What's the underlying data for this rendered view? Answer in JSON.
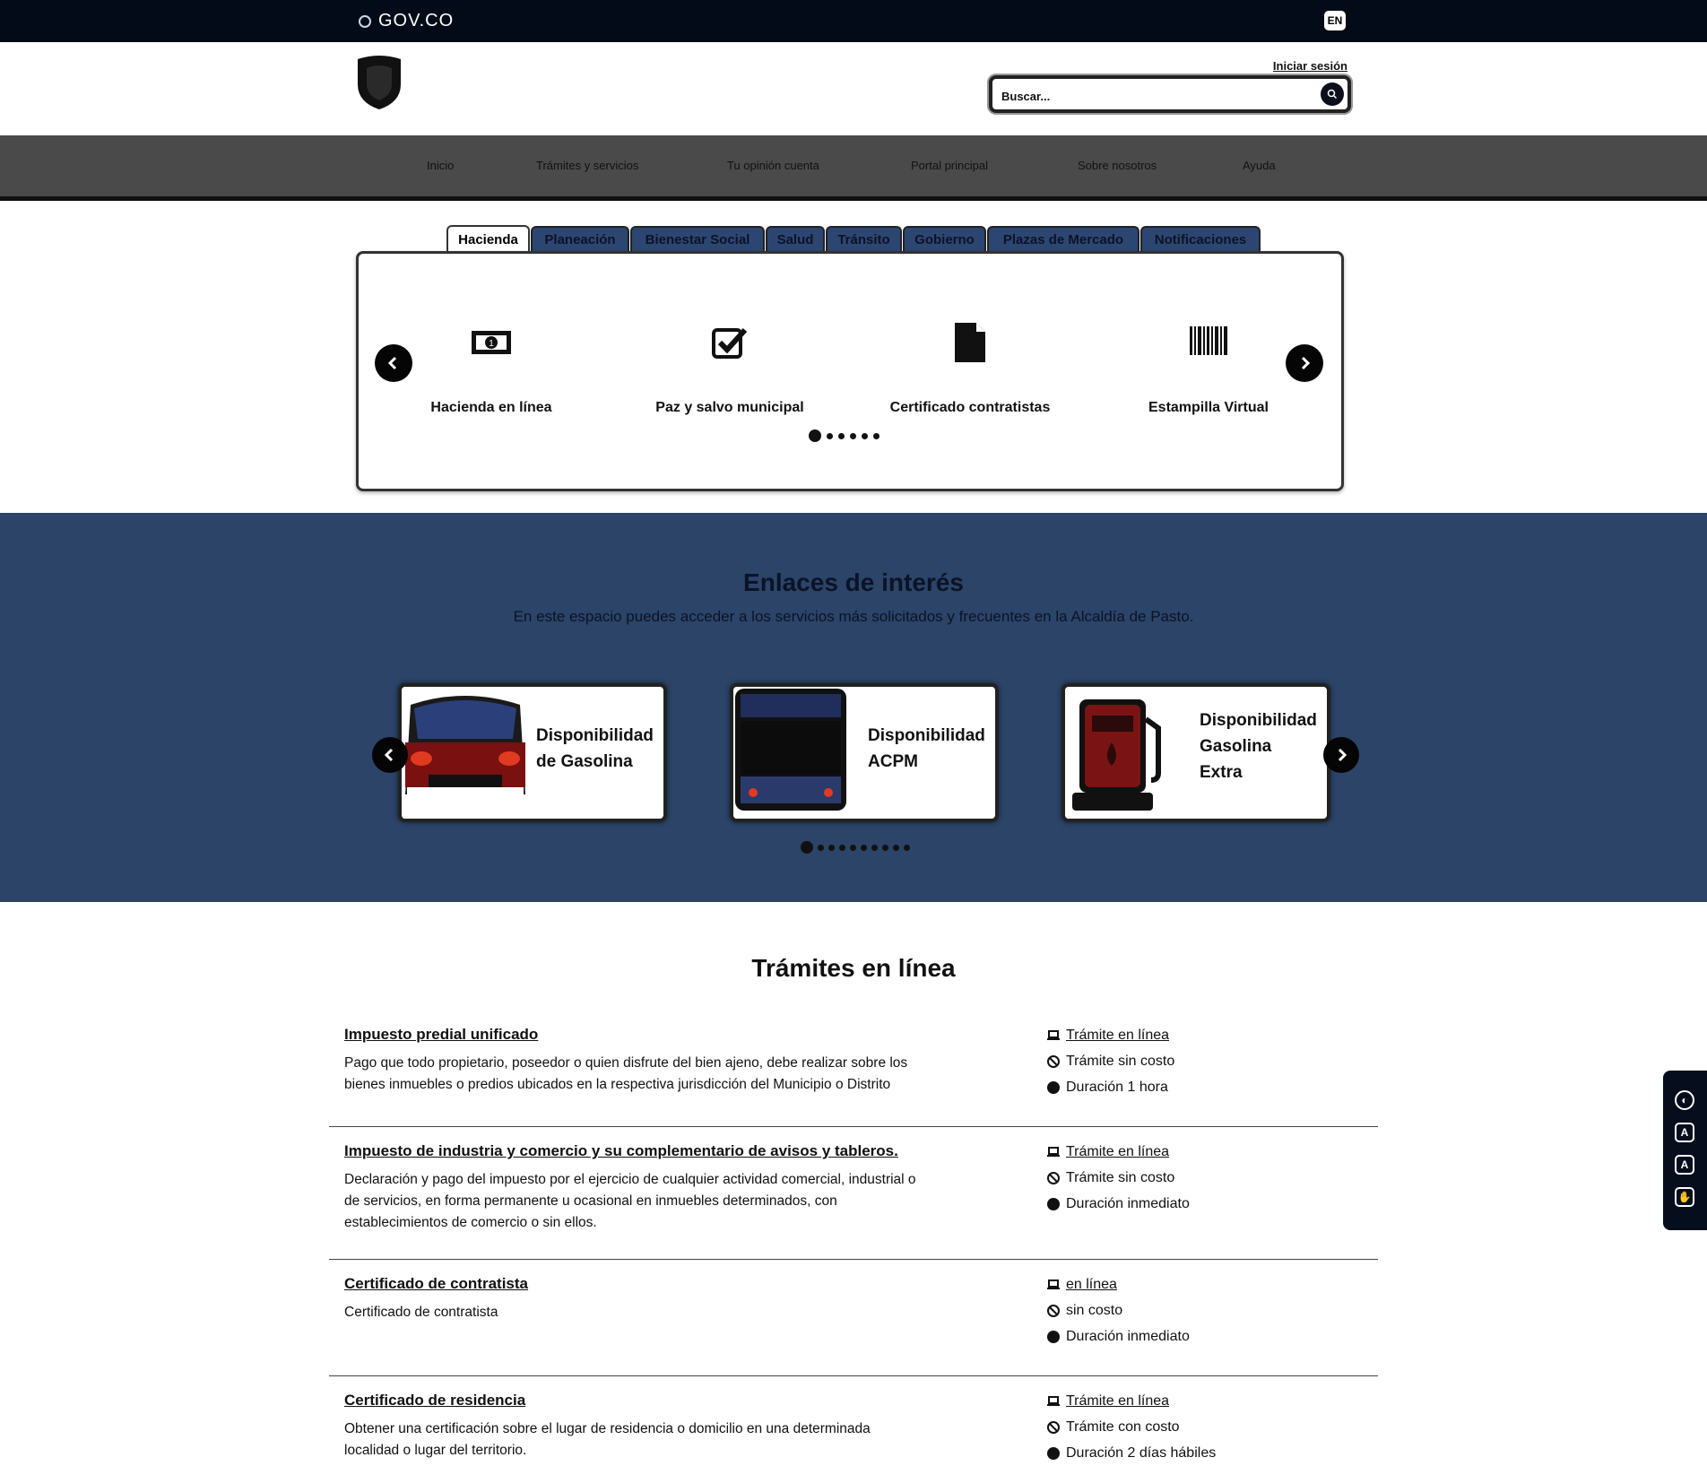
{
  "gov": {
    "logo_text": "GOV.CO",
    "lang_label": "EN"
  },
  "header": {
    "login_label": "Iniciar sesión",
    "search_placeholder": "Buscar..."
  },
  "nav": {
    "items": [
      "Inicio",
      "Trámites y servicios",
      "Tu opinión cuenta",
      "Portal principal",
      "Sobre nosotros",
      "Ayuda"
    ]
  },
  "tabs": [
    "Hacienda",
    "Planeación",
    "Bienestar Social",
    "Salud",
    "Tránsito",
    "Gobierno",
    "Plazas de Mercado",
    "Notificaciones"
  ],
  "active_tab": "Hacienda",
  "services": [
    {
      "label": "Hacienda en línea",
      "icon": "money-bill-icon"
    },
    {
      "label": "Paz y salvo municipal",
      "icon": "checkbox-icon"
    },
    {
      "label": "Certificado contratistas",
      "icon": "document-icon"
    },
    {
      "label": "Estampilla Virtual",
      "icon": "barcode-icon"
    }
  ],
  "enlaces": {
    "title": "Enlaces de interés",
    "subtitle": "En este espacio puedes acceder a los servicios más solicitados y frecuentes en la Alcaldía de Pasto.",
    "cards": [
      {
        "title_lines": [
          "Disponibilidad",
          "de Gasolina"
        ],
        "image": "car-image"
      },
      {
        "title_lines": [
          "Disponibilidad",
          "ACPM"
        ],
        "image": "bus-image"
      },
      {
        "title_lines": [
          "Disponibilidad",
          "Gasolina",
          "Extra"
        ],
        "image": "fuel-pump-image"
      }
    ]
  },
  "tramites": {
    "title": "Trámites en línea",
    "items": [
      {
        "title": "Impuesto predial unificado",
        "desc_lines": [
          "Pago que todo propietario, poseedor o quien disfrute del bien ajeno, debe realizar sobre los",
          "bienes inmuebles o predios ubicados en la respectiva jurisdicción del Municipio o Distrito"
        ],
        "mode": "Trámite en línea",
        "cost": "Trámite sin costo",
        "duration": "Duración 1 hora"
      },
      {
        "title": "Impuesto de industria y comercio y su complementario de avisos y tableros.",
        "desc_lines": [
          "Declaración y pago del impuesto por el ejercicio de cualquier actividad comercial, industrial o",
          "de servicios, en forma permanente u ocasional en inmuebles determinados, con",
          "establecimientos de comercio o sin ellos."
        ],
        "mode": "Trámite en línea",
        "cost": "Trámite sin costo",
        "duration": "Duración inmediato"
      },
      {
        "title": "Certificado de contratista",
        "desc_lines": [
          "Certificado de contratista"
        ],
        "mode": "en línea",
        "cost": "sin costo",
        "duration": "Duración inmediato"
      },
      {
        "title": "Certificado de residencia",
        "desc_lines": [
          "Obtener una certificación sobre el lugar de residencia o domicilio en una determinada",
          "localidad o lugar del territorio."
        ],
        "mode": "Trámite en línea",
        "cost": "Trámite con costo",
        "duration": "Duración 2 días hábiles"
      }
    ]
  },
  "colors": {
    "gov_bar": "#030b18",
    "nav": "#4a4a4a",
    "band": "#2b4468",
    "tab": "#2d4671"
  }
}
